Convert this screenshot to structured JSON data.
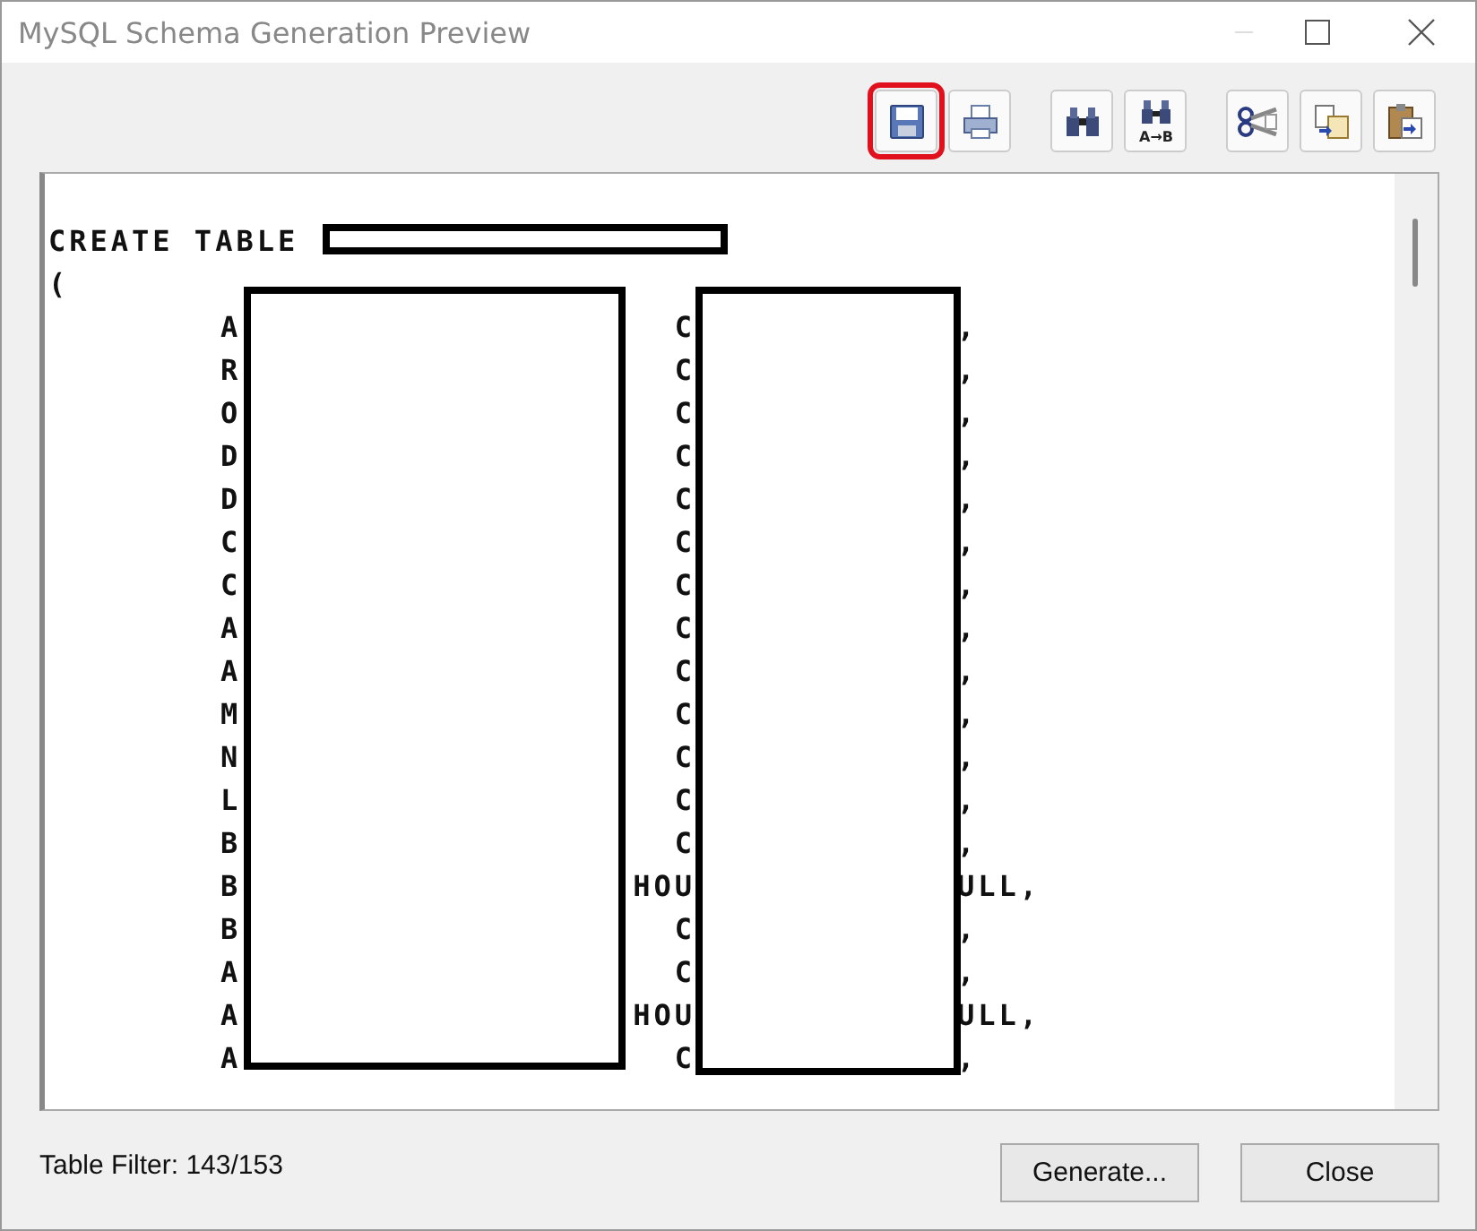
{
  "window": {
    "title": "MySQL Schema Generation Preview"
  },
  "toolbar": [
    {
      "kind": "save",
      "highlighted": true
    },
    {
      "kind": "print",
      "highlighted": false
    },
    {
      "kind": "find",
      "highlighted": false
    },
    {
      "kind": "replace",
      "caption": "A→B",
      "highlighted": false
    },
    {
      "kind": "cut",
      "highlighted": false
    },
    {
      "kind": "copy",
      "highlighted": false
    },
    {
      "kind": "paste",
      "highlighted": false
    }
  ],
  "editor": {
    "header": "CREATE TABLE",
    "open_paren": "(",
    "rows": [
      {
        "name": "A",
        "type": "C",
        "end": ","
      },
      {
        "name": "R",
        "type": "C",
        "end": ","
      },
      {
        "name": "O",
        "type": "C",
        "end": ","
      },
      {
        "name": "D",
        "type": "C",
        "end": ","
      },
      {
        "name": "D",
        "type": "C",
        "end": ","
      },
      {
        "name": "C",
        "type": "C",
        "end": ","
      },
      {
        "name": "C",
        "type": "C",
        "end": ","
      },
      {
        "name": "A",
        "type": "C",
        "end": ","
      },
      {
        "name": "A",
        "type": "C",
        "end": ","
      },
      {
        "name": "M",
        "type": "C",
        "end": ","
      },
      {
        "name": "N",
        "type": "C",
        "end": ","
      },
      {
        "name": "L",
        "type": "C",
        "end": ","
      },
      {
        "name": "B",
        "type": "C",
        "end": ","
      },
      {
        "name": "B",
        "type": "HOU",
        "end": "ULL,"
      },
      {
        "name": "B",
        "type": "C",
        "end": ","
      },
      {
        "name": "A",
        "type": "C",
        "end": ","
      },
      {
        "name": "A",
        "type": "HOU",
        "end": "ULL,"
      },
      {
        "name": "A",
        "type": "C",
        "end": ","
      }
    ]
  },
  "status": "Table Filter: 143/153",
  "buttons": [
    "Generate...",
    "Close"
  ]
}
